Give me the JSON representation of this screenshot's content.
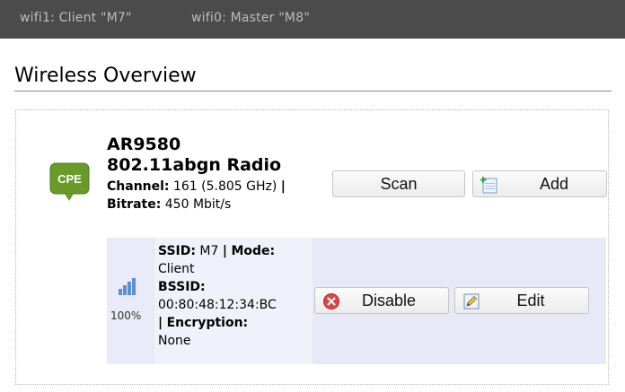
{
  "topbar": {
    "status_1": "wifi1: Client \"M7\"",
    "status_2": "wifi0: Master \"M8\""
  },
  "section": {
    "title": "Wireless Overview"
  },
  "radio": {
    "icon": "cpe-icon",
    "name_line1": "AR9580",
    "name_line2": "802.11abgn Radio",
    "channel_label": "Channel:",
    "channel_value": "161 (5.805 GHz)",
    "sep": "|",
    "bitrate_label": "Bitrate:",
    "bitrate_value": "450 Mbit/s",
    "scan_label": "Scan",
    "add_label": "Add"
  },
  "network": {
    "signal_icon": "signal-bars-icon",
    "signal_quality": "100%",
    "ssid_label": "SSID:",
    "ssid_value": "M7",
    "sep": "|",
    "mode_label": "Mode:",
    "mode_value": "Client",
    "bssid_label": "BSSID:",
    "bssid_value": "00:80:48:12:34:BC",
    "encryption_label": "Encryption:",
    "encryption_value": "None",
    "disable_label": "Disable",
    "edit_label": "Edit"
  },
  "colors": {
    "topbar_bg": "#4b4b4b",
    "cpe_green": "#6a9a2a",
    "network_row_bg": "#e8e8f7"
  }
}
